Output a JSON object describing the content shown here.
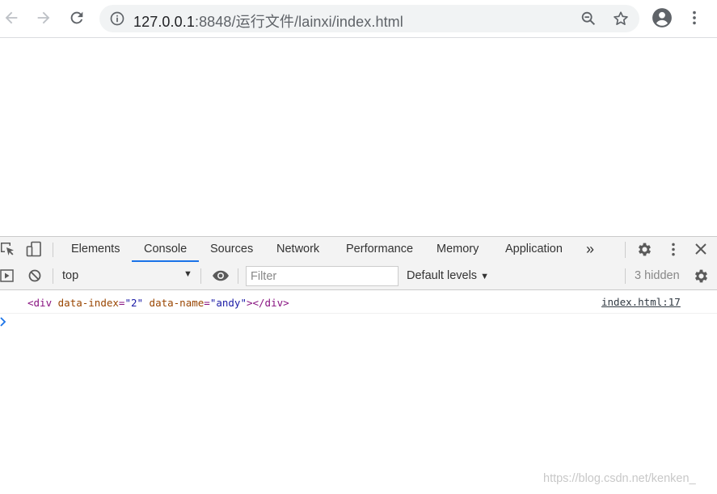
{
  "browser": {
    "url_host": "127.0.0.1",
    "url_rest": ":8848/运行文件/lainxi/index.html",
    "icons": [
      "back-arrow-icon",
      "forward-arrow-icon",
      "reload-icon",
      "info-icon",
      "zoom-out-icon",
      "star-icon",
      "account-icon",
      "more-vert-icon"
    ]
  },
  "devtools": {
    "tabs": [
      "Elements",
      "Console",
      "Sources",
      "Network",
      "Performance",
      "Memory",
      "Application"
    ],
    "active_tab": "Console",
    "overflow_label": "»",
    "accent_color": "#1a73e8"
  },
  "console_toolbar": {
    "context": "top",
    "filter_placeholder": "Filter",
    "levels": "Default levels",
    "hidden": "3 hidden"
  },
  "console": {
    "log": {
      "open_tag": "<div",
      "attr1_name": "data-index",
      "attr1_value": "\"2\"",
      "attr2_name": "data-name",
      "attr2_value": "\"andy\"",
      "close": "></div>",
      "source": "index.html:17"
    },
    "prompt_symbol": ">"
  },
  "watermark": "https://blog.csdn.net/kenken_"
}
